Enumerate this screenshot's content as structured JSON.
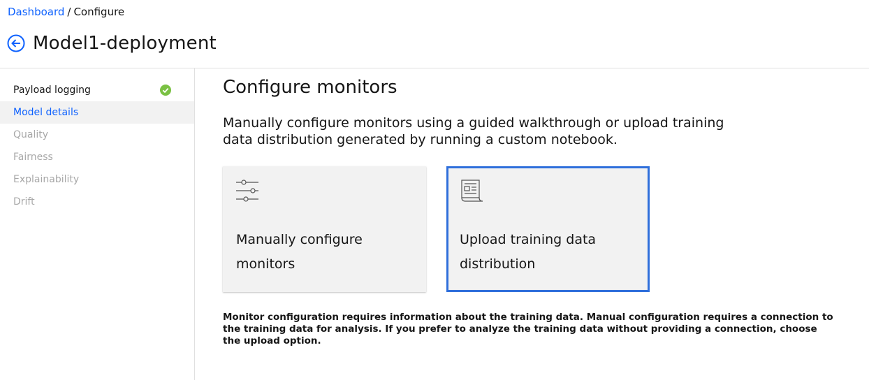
{
  "breadcrumb": {
    "parent": "Dashboard",
    "separator": "/",
    "current": "Configure"
  },
  "header": {
    "back_icon": "arrow-left-circle-icon",
    "title": "Model1-deployment"
  },
  "sidebar": {
    "items": [
      {
        "label": "Payload logging",
        "state": "complete",
        "icon": "checkmark-filled-icon",
        "icon_color": "#7ac143"
      },
      {
        "label": "Model details",
        "state": "active"
      },
      {
        "label": "Quality",
        "state": "disabled"
      },
      {
        "label": "Fairness",
        "state": "disabled"
      },
      {
        "label": "Explainability",
        "state": "disabled"
      },
      {
        "label": "Drift",
        "state": "disabled"
      }
    ]
  },
  "main": {
    "title": "Configure monitors",
    "intro": "Manually configure monitors using a guided walkthrough or upload training data distribution generated by running a custom notebook.",
    "tiles": [
      {
        "label": "Manually configure monitors",
        "icon": "sliders-icon",
        "selected": false
      },
      {
        "label": "Upload training data distribution",
        "icon": "document-report-icon",
        "selected": true
      }
    ],
    "note": "Monitor configuration requires information about the training data. Manual configuration requires a connection to the training data for analysis. If you prefer to analyze the training data without providing a connection, choose the upload option."
  },
  "colors": {
    "link": "#0f62fe",
    "selected_border": "#2f6fdb",
    "tile_bg": "#f2f2f2",
    "success": "#7ac143"
  }
}
